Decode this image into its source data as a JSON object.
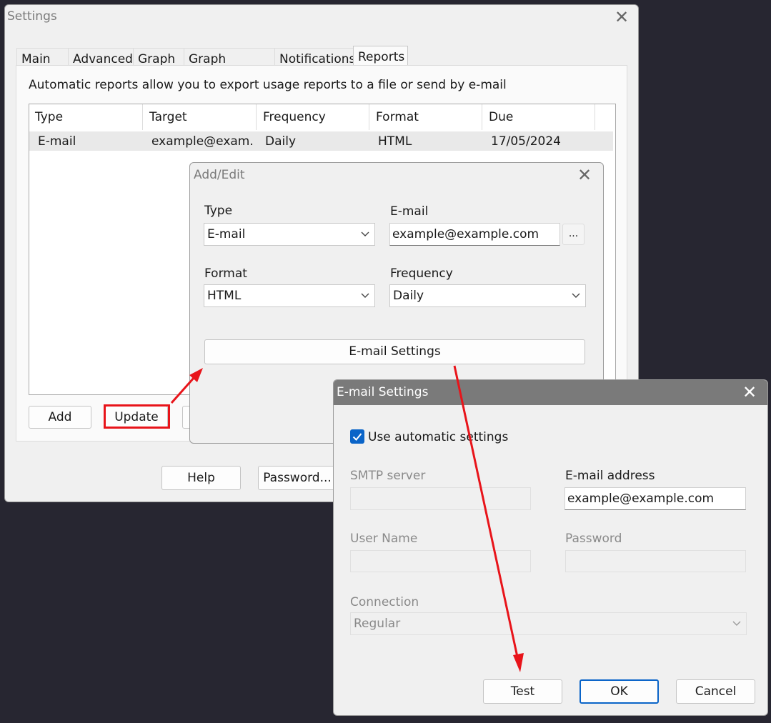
{
  "settings": {
    "title": "Settings",
    "tabs": [
      "Main",
      "Advanced",
      "Graph",
      "Graph Colours",
      "Notifications",
      "Reports"
    ],
    "description": "Automatic reports allow you to export usage reports to a file or send by e-mail",
    "table": {
      "headers": [
        "Type",
        "Target",
        "Frequency",
        "Format",
        "Due"
      ],
      "rows": [
        [
          "E-mail",
          "example@exam...",
          "Daily",
          "HTML",
          "17/05/2024"
        ]
      ]
    },
    "buttons": {
      "add": "Add",
      "update": "Update",
      "help": "Help",
      "password": "Password..."
    }
  },
  "add_edit": {
    "title": "Add/Edit",
    "type_label": "Type",
    "type_value": "E-mail",
    "email_label": "E-mail",
    "email_value": "example@example.com",
    "browse": "...",
    "format_label": "Format",
    "format_value": "HTML",
    "frequency_label": "Frequency",
    "frequency_value": "Daily",
    "email_settings_button": "E-mail Settings"
  },
  "email_settings": {
    "title": "E-mail Settings",
    "auto_label": "Use automatic settings",
    "auto_checked": true,
    "smtp_label": "SMTP server",
    "smtp_value": "",
    "address_label": "E-mail address",
    "address_value": "example@example.com",
    "username_label": "User Name",
    "username_value": "",
    "password_label": "Password",
    "password_value": "",
    "connection_label": "Connection",
    "connection_value": "Regular",
    "buttons": {
      "test": "Test",
      "ok": "OK",
      "cancel": "Cancel"
    }
  },
  "colors": {
    "accent": "#0a64c8",
    "annotation": "#e8141a",
    "background": "#272631"
  }
}
